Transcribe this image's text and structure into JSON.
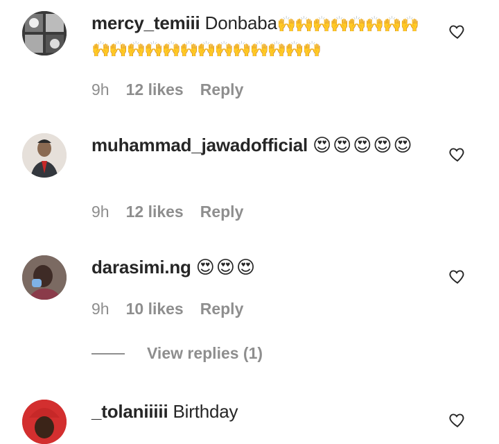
{
  "comments": [
    {
      "username": "mercy_temiii",
      "text": "Donbaba",
      "emoji": "🙌🙌🙌🙌🙌🙌🙌🙌🙌🙌🙌🙌🙌🙌🙌🙌🙌🙌🙌🙌🙌",
      "time": "9h",
      "likes": "12 likes",
      "reply": "Reply"
    },
    {
      "username": "muhammad_jawadofficial",
      "text": "",
      "emoji": "😍😍😍😍😍",
      "time": "9h",
      "likes": "12 likes",
      "reply": "Reply"
    },
    {
      "username": "darasimi.ng",
      "text": "",
      "emoji": "😍😍😍",
      "time": "9h",
      "likes": "10 likes",
      "reply": "Reply"
    },
    {
      "username": "_tolaniiiii",
      "text": "Birthday",
      "emoji": "",
      "time": "",
      "likes": "",
      "reply": ""
    }
  ],
  "view_replies": "View replies (1)",
  "icons": {
    "like": "heart-outline-icon"
  }
}
